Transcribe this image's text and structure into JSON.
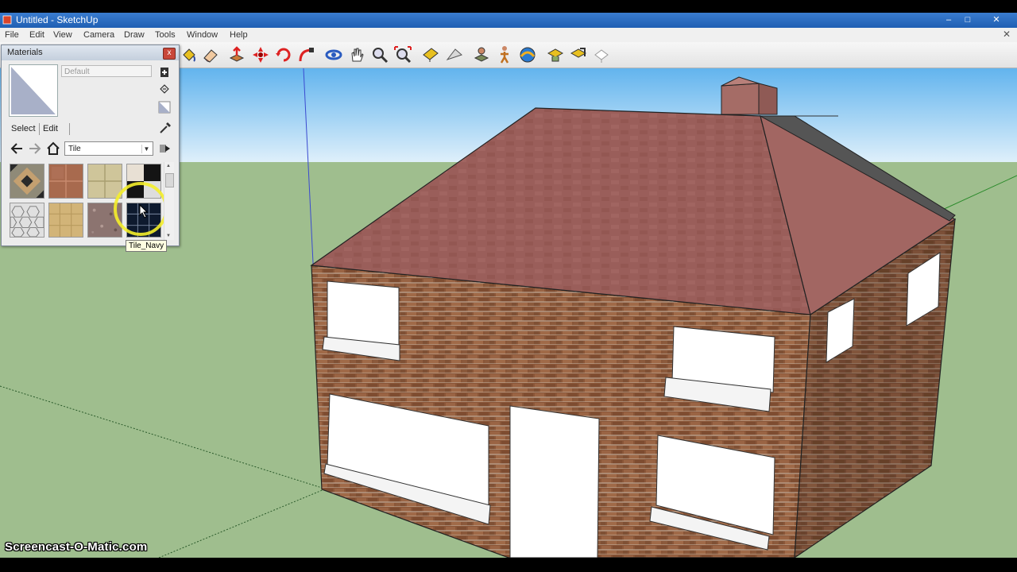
{
  "window": {
    "title": "Untitled - SketchUp"
  },
  "menu": [
    "File",
    "Edit",
    "View",
    "Camera",
    "Draw",
    "Tools",
    "Window",
    "Help"
  ],
  "toolbar_icons": [
    "paint-bucket-icon",
    "eraser-icon",
    "push-pull-icon",
    "move-icon",
    "rotate-icon",
    "follow-me-icon",
    "orbit-icon",
    "pan-icon",
    "zoom-icon",
    "zoom-extents-icon",
    "tape-measure-icon",
    "protractor-icon",
    "position-camera-icon",
    "walk-icon",
    "look-around-icon",
    "section-plane-icon",
    "component-icon",
    "axes-icon"
  ],
  "materials": {
    "title": "Materials",
    "close_label": "x",
    "current_name": "Default",
    "tabs": [
      "Select",
      "Edit"
    ],
    "library": "Tile",
    "swatches": [
      "Tile_Diamond",
      "Tile_Terracotta",
      "Tile_Beige",
      "Tile_Checker",
      "Tile_Hexagon",
      "Tile_Sand",
      "Tile_Granite",
      "Tile_Navy"
    ],
    "selected_swatch": "Tile_Navy",
    "tooltip": "Tile_Navy"
  },
  "watermark": "Screencast-O-Matic.com",
  "colors": {
    "sky_top": "#62b4ee",
    "sky_bottom": "#e6f3fb",
    "ground": "#9fbe8e",
    "roof": "#9a5e5a",
    "brick": "#8a5638",
    "window": "#ffffff",
    "highlight_ring": "#f4ee2a"
  }
}
